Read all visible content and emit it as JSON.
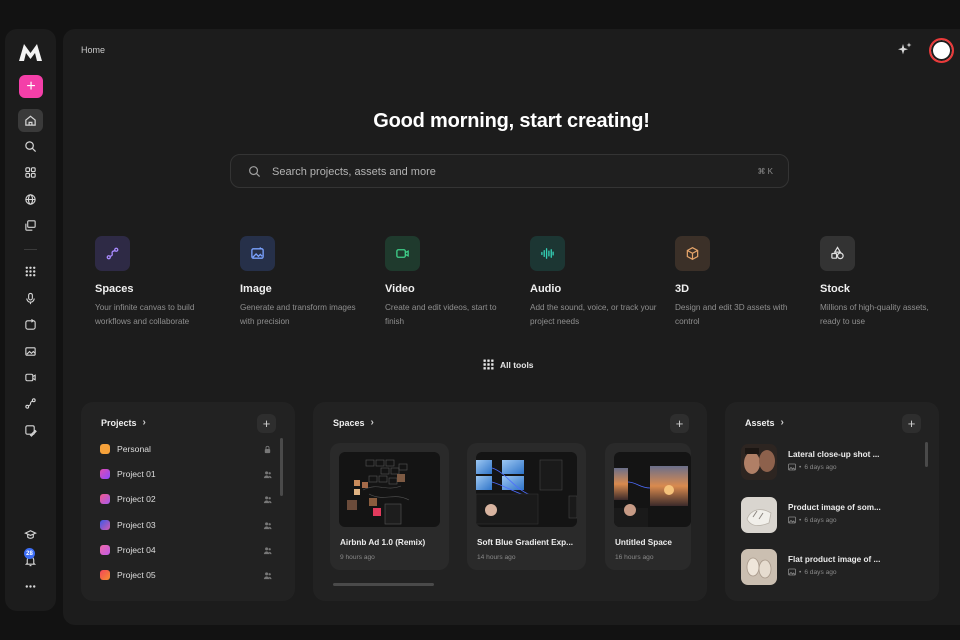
{
  "breadcrumb": "Home",
  "greeting": "Good morning, start creating!",
  "search": {
    "placeholder": "Search projects, assets and more",
    "shortcut": "⌘ K"
  },
  "sidebar": {
    "notification_count": "28",
    "items": [
      {
        "icon": "home-icon"
      },
      {
        "icon": "search-icon"
      },
      {
        "icon": "apps-icon"
      },
      {
        "icon": "globe-icon"
      },
      {
        "icon": "library-icon"
      },
      {
        "icon": "grid-icon"
      },
      {
        "icon": "microphone-icon"
      },
      {
        "icon": "video-icon"
      },
      {
        "icon": "image-icon"
      },
      {
        "icon": "camera-icon"
      },
      {
        "icon": "path-icon"
      },
      {
        "icon": "edit-image-icon"
      },
      {
        "icon": "learn-icon"
      },
      {
        "icon": "bell-icon"
      },
      {
        "icon": "more-icon"
      }
    ]
  },
  "tools": [
    {
      "title": "Spaces",
      "desc": "Your infinite canvas to build workflows and collaborate",
      "color": "#a98bff",
      "bg": "#2e2a45",
      "icon": "spaces-icon"
    },
    {
      "title": "Image",
      "desc": "Generate and transform images with precision",
      "color": "#7aa2ff",
      "bg": "#263049",
      "icon": "image-icon"
    },
    {
      "title": "Video",
      "desc": "Create and edit videos, start to finish",
      "color": "#3fd08a",
      "bg": "#1f3a2d",
      "icon": "video-icon"
    },
    {
      "title": "Audio",
      "desc": "Add the sound, voice, or track your project needs",
      "color": "#34d1b7",
      "bg": "#1c3633",
      "icon": "audio-wave-icon"
    },
    {
      "title": "3D",
      "desc": "Design and edit 3D assets with control",
      "color": "#e5a46a",
      "bg": "#3b3028",
      "icon": "cube-icon"
    },
    {
      "title": "Stock",
      "desc": "Millions of high-quality assets, ready to use",
      "color": "#e0e0e0",
      "bg": "#333333",
      "icon": "shapes-icon"
    }
  ],
  "all_tools_label": "All tools",
  "projects": {
    "title": "Projects",
    "items": [
      {
        "label": "Personal",
        "color": "#f5a13a",
        "icon": "lock-icon"
      },
      {
        "label": "Project 01",
        "color": "#c64fd9",
        "icon": "team-icon"
      },
      {
        "label": "Project 02",
        "color": "#e0589e",
        "icon": "team-icon"
      },
      {
        "label": "Project 03",
        "color": "#5668e6",
        "icon": "team-icon"
      },
      {
        "label": "Project 04",
        "color": "#ef6bb0",
        "icon": "team-icon"
      },
      {
        "label": "Project 05",
        "color": "#f05a3b",
        "icon": "team-icon"
      }
    ]
  },
  "spaces": {
    "title": "Spaces",
    "items": [
      {
        "title": "Airbnb Ad 1.0 (Remix)",
        "time": "9 hours ago"
      },
      {
        "title": "Soft Blue Gradient Exp...",
        "time": "14 hours ago"
      },
      {
        "title": "Untitled Space",
        "time": "16 hours ago"
      }
    ]
  },
  "assets": {
    "title": "Assets",
    "items": [
      {
        "title": "Lateral close-up shot ...",
        "time": "6 days ago"
      },
      {
        "title": "Product image of som...",
        "time": "6 days ago"
      },
      {
        "title": "Flat product image of ...",
        "time": "6 days ago"
      }
    ]
  }
}
